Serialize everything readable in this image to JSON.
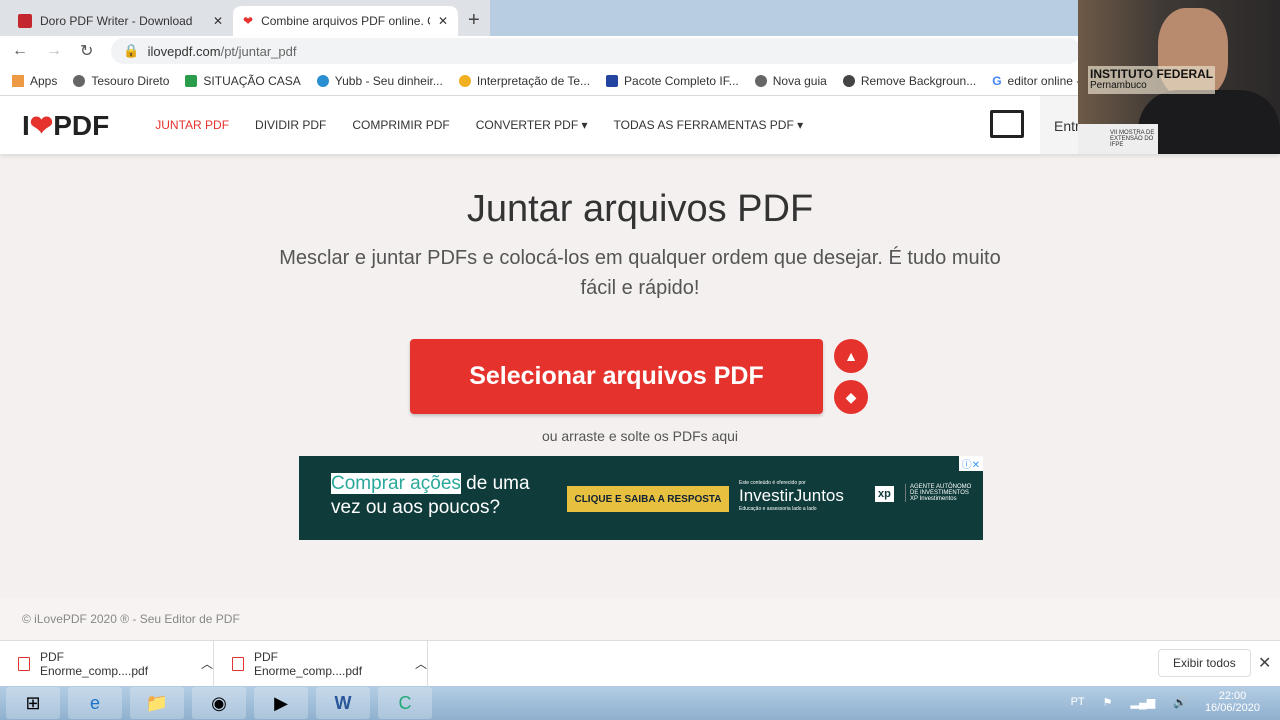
{
  "browser": {
    "tabs": [
      {
        "title": "Doro PDF Writer - Download",
        "icon": "doro-icon",
        "color": "#c4262e"
      },
      {
        "title": "Combine arquivos PDF online. C",
        "icon": "ilovepdf-heart-icon",
        "color": "#e5322d",
        "active": true
      }
    ],
    "url_domain": "ilovepdf.com",
    "url_path": "/pt/juntar_pdf",
    "bookmarks": [
      "Apps",
      "Tesouro Direto",
      "SITUAÇÃO CASA",
      "Yubb - Seu dinheir...",
      "Interpretação de Te...",
      "Pacote Completo IF...",
      "Nova guia",
      "Remove Backgroun...",
      "editor online - P"
    ]
  },
  "site": {
    "logo": {
      "left": "I",
      "right": "PDF"
    },
    "nav": [
      "JUNTAR PDF",
      "DIVIDIR PDF",
      "COMPRIMIR PDF",
      "CONVERTER PDF ▾",
      "TODAS AS FERRAMENTAS PDF ▾"
    ],
    "login": "Entr",
    "title": "Juntar arquivos PDF",
    "subtitle": "Mesclar e juntar PDFs e colocá-los em qualquer ordem que desejar. É tudo muito fácil e rápido!",
    "select_button": "Selecionar arquivos PDF",
    "drag_hint": "ou arraste e solte os PDFs aqui",
    "footer": "© iLovePDF 2020 ® - Seu Editor de PDF",
    "accent": "#e5322d"
  },
  "ad": {
    "highlight": "Comprar ações",
    "rest1": " de uma",
    "line2": "vez ou aos poucos?",
    "cta": "CLIQUE E SAIBA A RESPOSTA",
    "sponsor_note": "Este conteúdo é oferecido por",
    "brand": "InvestirJuntos",
    "brand_tag": "Educação e assessoria lado a lado",
    "xp": "xp",
    "xp_text": "AGENTE AUTÔNOMO DE INVESTIMENTOS XP Investimentos"
  },
  "webcam": {
    "logo": "INSTITUTO FEDERAL",
    "logo_sub": "Pernambuco",
    "badge": "VII MOSTRA DE EXTENSÃO DO IFPE"
  },
  "downloads": {
    "items": [
      "PDF Enorme_comp....pdf",
      "PDF Enorme_comp....pdf"
    ],
    "show_all": "Exibir todos"
  },
  "taskbar": {
    "lang": "PT",
    "time": "22:00",
    "date": "16/06/2020"
  }
}
